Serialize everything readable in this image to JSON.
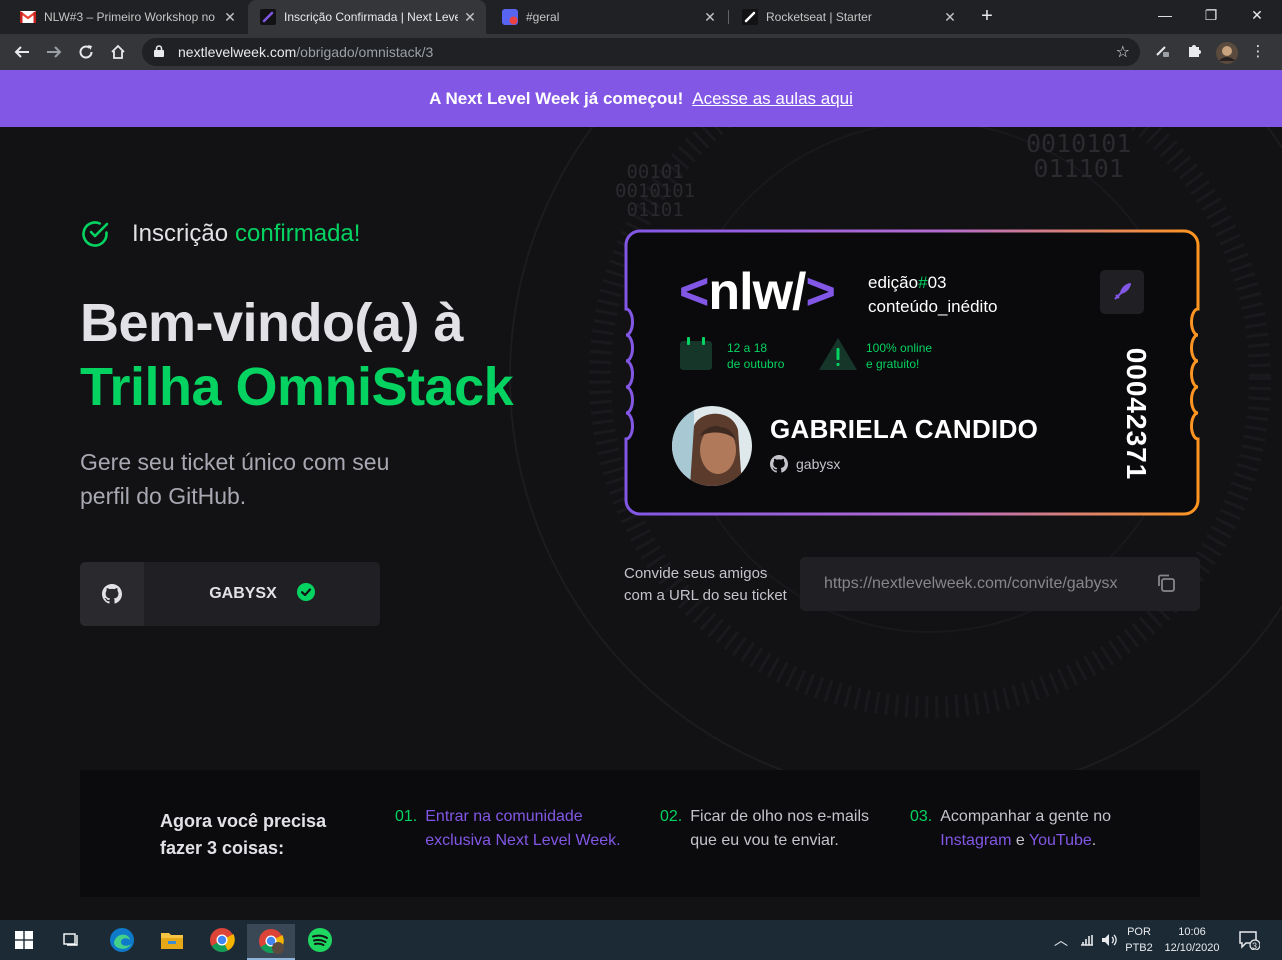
{
  "browser": {
    "tabs": [
      {
        "title": "NLW#3 – Primeiro Workshop no",
        "icon": "gmail-icon",
        "active": false
      },
      {
        "title": "Inscrição Confirmada | Next Level",
        "icon": "rocketseat-icon",
        "active": true
      },
      {
        "title": "#geral",
        "icon": "discord-icon",
        "active": false
      },
      {
        "title": "Rocketseat | Starter",
        "icon": "rocketseat-icon",
        "active": false
      }
    ],
    "url_host": "nextlevelweek.com",
    "url_path": "/obrigado/omnistack/3"
  },
  "banner": {
    "text": "A Next Level Week já começou!",
    "link": "Acesse as aulas aqui"
  },
  "hero": {
    "confirm_prefix": "Inscrição",
    "confirm_suffix": "confirmada!",
    "title_line1": "Bem-vindo(a) à",
    "title_line2": "Trilha OmniStack",
    "subtitle": "Gere seu ticket único com seu perfil do GitHub.",
    "github_user": "GABYSX"
  },
  "ticket": {
    "logo_open": "<",
    "logo_text": "nlw/",
    "logo_close": ">",
    "edition_prefix": "edição",
    "edition_hash": "#",
    "edition_number": "03",
    "content": "conteúdo_inédito",
    "date_line1": "12 a 18",
    "date_line2": "de outubro",
    "online_line1": "100% online",
    "online_line2": "e gratuito!",
    "name": "GABRIELA CANDIDO",
    "login": "gabysx",
    "number": "00042371"
  },
  "invite": {
    "label_line1": "Convide seus amigos",
    "label_line2": "com a URL do seu ticket",
    "url": "https://nextlevelweek.com/convite/gabysx"
  },
  "steps": {
    "lead_line1": "Agora você precisa",
    "lead_line2": "fazer 3 coisas:",
    "s1_num": "01.",
    "s1_line1": "Entrar na comunidade",
    "s1_line2": "exclusiva Next Level Week.",
    "s2_num": "02.",
    "s2_line1": "Ficar de olho nos e-mails",
    "s2_line2": "que eu vou te enviar.",
    "s3_num": "03.",
    "s3_line1": "Acompanhar a gente no",
    "s3_link1": "Instagram",
    "s3_and": "e",
    "s3_link2": "YouTube",
    "s3_end": "."
  },
  "taskbar": {
    "lang1": "POR",
    "lang2": "PTB2",
    "time": "10:06",
    "date": "12/10/2020",
    "notifications": "3"
  },
  "colors": {
    "purple": "#8257e5",
    "green": "#04d361",
    "orange": "#fd951f",
    "bg": "#121214"
  }
}
